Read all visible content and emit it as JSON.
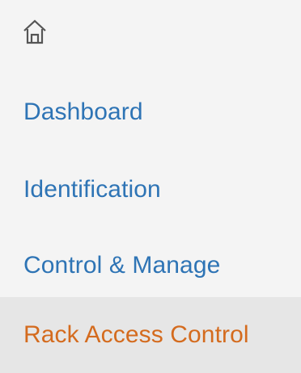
{
  "colors": {
    "link": "#2e74b5",
    "active": "#d46b1e",
    "icon": "#555555"
  },
  "home": {
    "icon": "home-icon"
  },
  "nav": {
    "items": [
      {
        "label": "Dashboard",
        "active": false
      },
      {
        "label": "Identification",
        "active": false
      },
      {
        "label": "Control & Manage",
        "active": false
      },
      {
        "label": "Rack Access Control",
        "active": true
      }
    ]
  }
}
